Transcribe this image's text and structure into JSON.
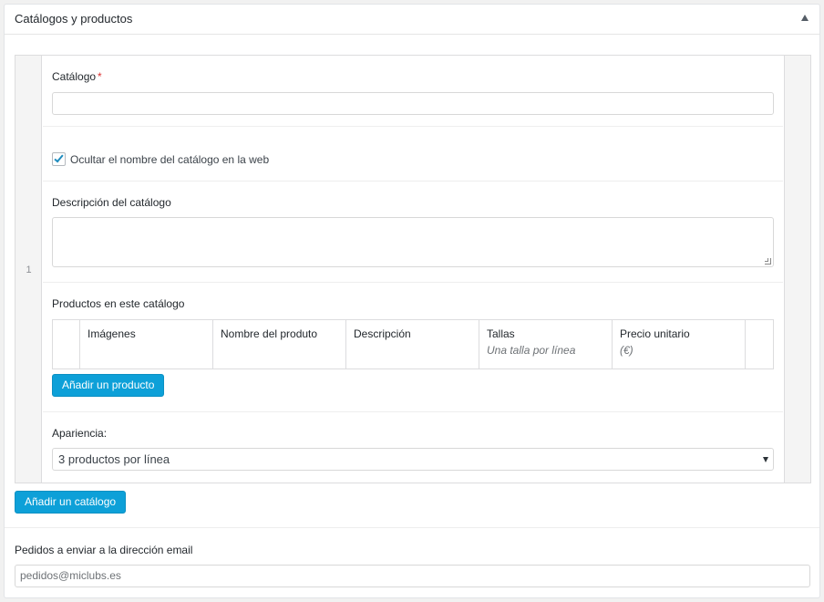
{
  "panel": {
    "title": "Catálogos y productos"
  },
  "catalog": {
    "row_number": "1",
    "name_label": "Catálogo",
    "required_mark": "*",
    "name_value": "",
    "hide_name": {
      "label": "Ocultar el nombre del catálogo en la web",
      "checked": true
    },
    "description_label": "Descripción del catálogo",
    "description_value": "",
    "products_label": "Productos en este catálogo",
    "product_columns": [
      {
        "label": "Imágenes",
        "sub": ""
      },
      {
        "label": "Nombre del produto",
        "sub": ""
      },
      {
        "label": "Descripción",
        "sub": ""
      },
      {
        "label": "Tallas",
        "sub": "Una talla por línea"
      },
      {
        "label": "Precio unitario",
        "sub": "(€)"
      }
    ],
    "add_product_button": "Añadir un producto",
    "appearance_label": "Apariencia:",
    "appearance_value": "3 productos por línea"
  },
  "add_catalog_button": "Añadir un catálogo",
  "orders_email": {
    "label": "Pedidos a enviar a la dirección email",
    "value": "pedidos@miclubs.es"
  },
  "colors": {
    "accent": "#0da0d8",
    "checkbox_check": "#1e8cbe",
    "required": "#dc3232"
  }
}
